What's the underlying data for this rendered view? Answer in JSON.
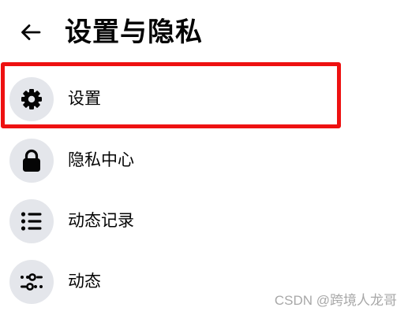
{
  "header": {
    "title": "设置与隐私",
    "back_icon": "arrow-left-icon"
  },
  "menu": {
    "items": [
      {
        "label": "设置",
        "icon": "gear-icon",
        "highlighted": true
      },
      {
        "label": "隐私中心",
        "icon": "lock-icon",
        "highlighted": false
      },
      {
        "label": "动态记录",
        "icon": "list-icon",
        "highlighted": false
      },
      {
        "label": "动态",
        "icon": "sliders-icon",
        "highlighted": false
      }
    ]
  },
  "annotation": {
    "highlight_color": "#ee1111"
  },
  "watermark": {
    "text": "CSDN @跨境人龙哥"
  }
}
